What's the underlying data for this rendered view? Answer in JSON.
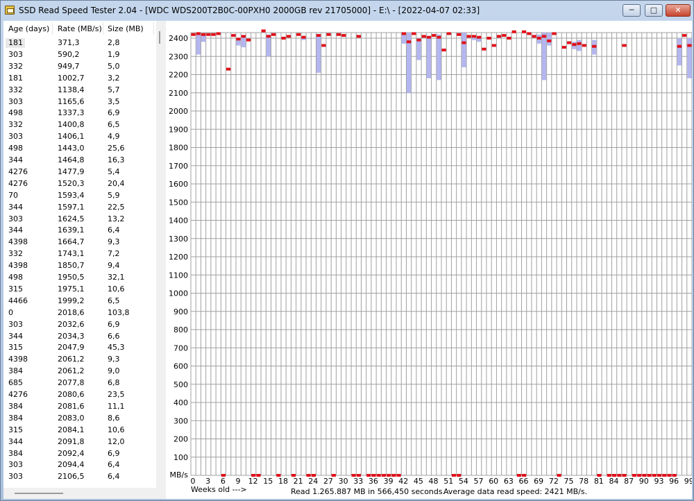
{
  "window": {
    "title": "SSD Read Speed Tester 2.04 - [WDC WDS200T2B0C-00PXH0 2000GB rev 21705000] - E:\\ - [2022-04-07 02:33]",
    "min_label": "─",
    "max_label": "□",
    "close_label": "✕",
    "icon": "app-drive-icon"
  },
  "list": {
    "headers": {
      "age": "Age (days)",
      "rate": "Rate (MB/s)",
      "size": "Size (MB)"
    },
    "rows": [
      {
        "age": "181",
        "rate": "371,3",
        "size": "2,8"
      },
      {
        "age": "303",
        "rate": "590,2",
        "size": "1,9"
      },
      {
        "age": "332",
        "rate": "949,7",
        "size": "5,0"
      },
      {
        "age": "181",
        "rate": "1002,7",
        "size": "3,2"
      },
      {
        "age": "332",
        "rate": "1138,4",
        "size": "5,7"
      },
      {
        "age": "303",
        "rate": "1165,6",
        "size": "3,5"
      },
      {
        "age": "498",
        "rate": "1337,3",
        "size": "6,9"
      },
      {
        "age": "332",
        "rate": "1400,8",
        "size": "6,5"
      },
      {
        "age": "303",
        "rate": "1406,1",
        "size": "4,9"
      },
      {
        "age": "498",
        "rate": "1443,0",
        "size": "25,6"
      },
      {
        "age": "344",
        "rate": "1464,8",
        "size": "16,3"
      },
      {
        "age": "4276",
        "rate": "1477,9",
        "size": "5,4"
      },
      {
        "age": "4276",
        "rate": "1520,3",
        "size": "20,4"
      },
      {
        "age": "70",
        "rate": "1593,4",
        "size": "5,9"
      },
      {
        "age": "344",
        "rate": "1597,1",
        "size": "22,5"
      },
      {
        "age": "303",
        "rate": "1624,5",
        "size": "13,2"
      },
      {
        "age": "344",
        "rate": "1639,1",
        "size": "6,4"
      },
      {
        "age": "4398",
        "rate": "1664,7",
        "size": "9,3"
      },
      {
        "age": "332",
        "rate": "1743,1",
        "size": "7,2"
      },
      {
        "age": "4398",
        "rate": "1850,7",
        "size": "9,4"
      },
      {
        "age": "498",
        "rate": "1950,5",
        "size": "32,1"
      },
      {
        "age": "315",
        "rate": "1975,1",
        "size": "10,6"
      },
      {
        "age": "4466",
        "rate": "1999,2",
        "size": "6,5"
      },
      {
        "age": "0",
        "rate": "2018,6",
        "size": "103,8"
      },
      {
        "age": "303",
        "rate": "2032,6",
        "size": "6,9"
      },
      {
        "age": "344",
        "rate": "2034,3",
        "size": "6,6"
      },
      {
        "age": "315",
        "rate": "2047,9",
        "size": "45,3"
      },
      {
        "age": "4398",
        "rate": "2061,2",
        "size": "9,3"
      },
      {
        "age": "384",
        "rate": "2061,2",
        "size": "9,0"
      },
      {
        "age": "685",
        "rate": "2077,8",
        "size": "6,8"
      },
      {
        "age": "4276",
        "rate": "2080,6",
        "size": "23,5"
      },
      {
        "age": "384",
        "rate": "2081,6",
        "size": "11,1"
      },
      {
        "age": "384",
        "rate": "2083,0",
        "size": "8,6"
      },
      {
        "age": "315",
        "rate": "2084,1",
        "size": "10,6"
      },
      {
        "age": "344",
        "rate": "2091,8",
        "size": "12,0"
      },
      {
        "age": "384",
        "rate": "2092,4",
        "size": "6,9"
      },
      {
        "age": "303",
        "rate": "2094,4",
        "size": "6,4"
      },
      {
        "age": "303",
        "rate": "2106,5",
        "size": "6,4"
      }
    ]
  },
  "chart": {
    "y_unit_label": "MB/s",
    "x_axis_caption": "Weeks old --->",
    "read_summary": "Read 1.265.887 MB in 566,450 seconds.",
    "avg_summary": "Average data read speed: 2421 MB/s.",
    "colors": {
      "grid": "#a0a0a0",
      "marker": "#e0101a",
      "range": "#b4b6f0",
      "background": "#ffffff"
    }
  },
  "chart_data": {
    "type": "scatter",
    "ylim": [
      0,
      2500
    ],
    "y_ticks": [
      100,
      200,
      300,
      400,
      500,
      600,
      700,
      800,
      900,
      1000,
      1100,
      1200,
      1300,
      1400,
      1500,
      1600,
      1700,
      1800,
      1900,
      2000,
      2100,
      2200,
      2300,
      2400
    ],
    "x_ticks": [
      0,
      3,
      6,
      9,
      12,
      15,
      18,
      21,
      24,
      27,
      30,
      33,
      36,
      39,
      42,
      45,
      48,
      51,
      54,
      57,
      60,
      63,
      66,
      69,
      72,
      75,
      78,
      81,
      84,
      87,
      90,
      93,
      96,
      99
    ],
    "xlim": [
      0,
      99
    ],
    "grid": true,
    "series": [
      {
        "description_role": "average",
        "points": [
          [
            0,
            2420
          ],
          [
            1,
            2425
          ],
          [
            2,
            2420
          ],
          [
            3,
            2420
          ],
          [
            4,
            2420
          ],
          [
            5,
            2425
          ],
          [
            7,
            2230
          ],
          [
            8,
            2415
          ],
          [
            9,
            2395
          ],
          [
            10,
            2410
          ],
          [
            11,
            2390
          ],
          [
            14,
            2440
          ],
          [
            15,
            2410
          ],
          [
            16,
            2420
          ],
          [
            18,
            2400
          ],
          [
            19,
            2410
          ],
          [
            21,
            2420
          ],
          [
            22,
            2405
          ],
          [
            25,
            2415
          ],
          [
            26,
            2360
          ],
          [
            27,
            2420
          ],
          [
            29,
            2420
          ],
          [
            30,
            2415
          ],
          [
            33,
            2410
          ],
          [
            42,
            2425
          ],
          [
            43,
            2380
          ],
          [
            44,
            2425
          ],
          [
            45,
            2390
          ],
          [
            46,
            2410
          ],
          [
            47,
            2405
          ],
          [
            48,
            2415
          ],
          [
            49,
            2405
          ],
          [
            50,
            2335
          ],
          [
            51,
            2425
          ],
          [
            53,
            2420
          ],
          [
            54,
            2375
          ],
          [
            55,
            2410
          ],
          [
            56,
            2410
          ],
          [
            57,
            2405
          ],
          [
            58,
            2340
          ],
          [
            59,
            2400
          ],
          [
            60,
            2360
          ],
          [
            61,
            2410
          ],
          [
            62,
            2415
          ],
          [
            63,
            2400
          ],
          [
            64,
            2435
          ],
          [
            66,
            2435
          ],
          [
            67,
            2425
          ],
          [
            68,
            2410
          ],
          [
            69,
            2400
          ],
          [
            70,
            2410
          ],
          [
            71,
            2385
          ],
          [
            72,
            2425
          ],
          [
            74,
            2350
          ],
          [
            75,
            2375
          ],
          [
            76,
            2365
          ],
          [
            77,
            2370
          ],
          [
            78,
            2360
          ],
          [
            80,
            2355
          ],
          [
            86,
            2360
          ],
          [
            97,
            2355
          ],
          [
            98,
            2415
          ],
          [
            99,
            2360
          ]
        ]
      },
      {
        "description_role": "range",
        "bars": [
          [
            1,
            2310,
            2420
          ],
          [
            2,
            2380,
            2420
          ],
          [
            9,
            2360,
            2400
          ],
          [
            10,
            2350,
            2410
          ],
          [
            15,
            2300,
            2420
          ],
          [
            22,
            2390,
            2410
          ],
          [
            25,
            2210,
            2420
          ],
          [
            42,
            2370,
            2430
          ],
          [
            43,
            2100,
            2430
          ],
          [
            45,
            2280,
            2400
          ],
          [
            47,
            2180,
            2400
          ],
          [
            49,
            2170,
            2420
          ],
          [
            54,
            2240,
            2430
          ],
          [
            56,
            2390,
            2410
          ],
          [
            57,
            2380,
            2410
          ],
          [
            69,
            2370,
            2420
          ],
          [
            70,
            2170,
            2430
          ],
          [
            71,
            2360,
            2430
          ],
          [
            76,
            2340,
            2380
          ],
          [
            77,
            2330,
            2390
          ],
          [
            80,
            2310,
            2390
          ],
          [
            97,
            2250,
            2400
          ],
          [
            99,
            2180,
            2400
          ]
        ]
      },
      {
        "description_role": "empty-weeks",
        "weeks": [
          6,
          12,
          13,
          17,
          20,
          23,
          24,
          28,
          32,
          33,
          35,
          36,
          37,
          38,
          39,
          40,
          41,
          52,
          53,
          65,
          66,
          73,
          81,
          83,
          84,
          85,
          86,
          88,
          89,
          90,
          91,
          92,
          93,
          94,
          95,
          96
        ]
      }
    ]
  }
}
